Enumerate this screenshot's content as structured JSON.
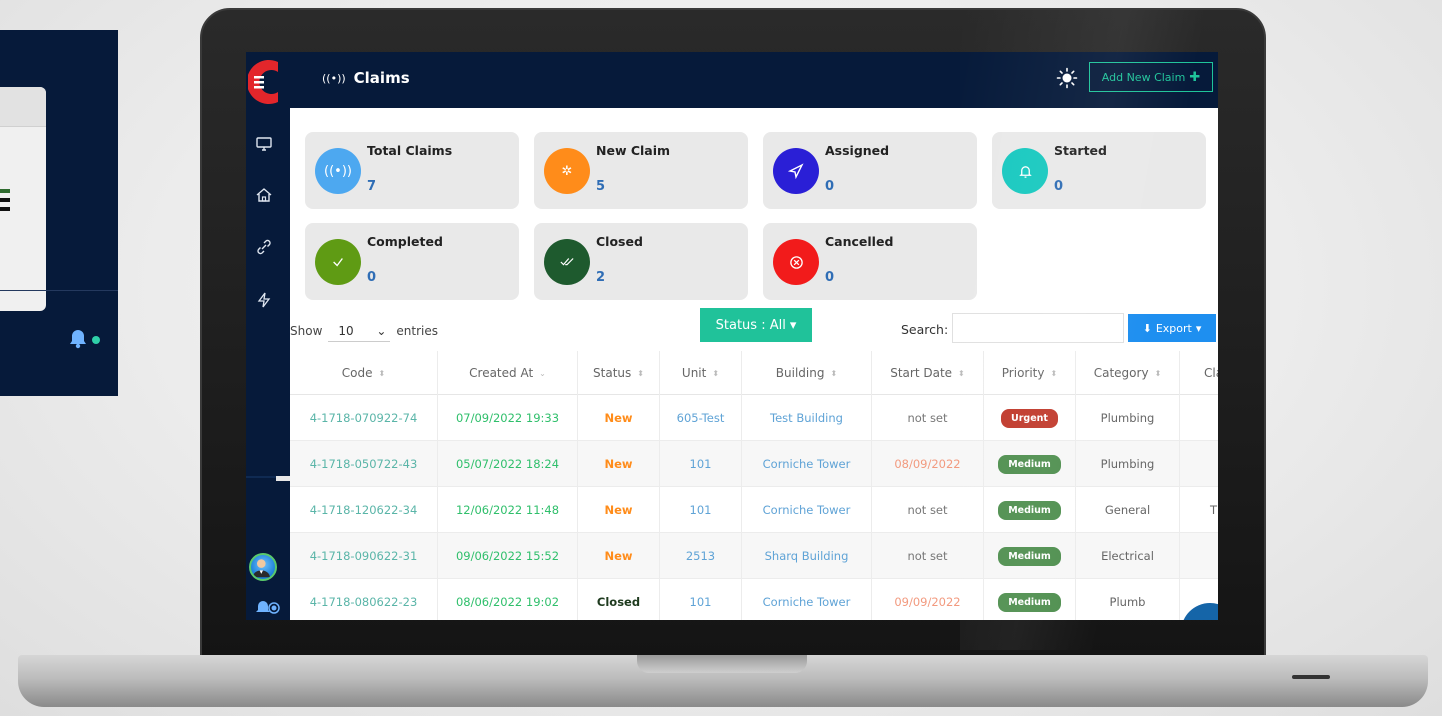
{
  "app": {
    "page_title": "Claims",
    "add_button_label": "Add New Claim",
    "colors": {
      "navy": "#061a3a",
      "teal": "#20c29a",
      "blue": "#1e8ff0"
    }
  },
  "stats": [
    {
      "label": "Total Claims",
      "value": "7",
      "color": "#4da8f0",
      "icon": "broadcast-icon"
    },
    {
      "label": "New Claim",
      "value": "5",
      "color": "#ff8c1a",
      "icon": "spinner-icon"
    },
    {
      "label": "Assigned",
      "value": "0",
      "color": "#2a1fd6",
      "icon": "send-icon"
    },
    {
      "label": "Started",
      "value": "0",
      "color": "#19c9c0",
      "icon": "bell-icon"
    },
    {
      "label": "Completed",
      "value": "0",
      "color": "#5f9b14",
      "icon": "check-icon"
    },
    {
      "label": "Closed",
      "value": "2",
      "color": "#1e5a2e",
      "icon": "double-check-icon"
    },
    {
      "label": "Cancelled",
      "value": "0",
      "color": "#f21b1b",
      "icon": "cancel-icon"
    }
  ],
  "controls": {
    "show_label": "Show",
    "entries_value": "10",
    "entries_label": "entries",
    "status_filter_label": "Status : All",
    "search_label": "Search:",
    "export_label": "Export"
  },
  "table": {
    "columns": [
      "Code",
      "Created At",
      "Status",
      "Unit",
      "Building",
      "Start Date",
      "Priority",
      "Category",
      "Cla"
    ],
    "rows": [
      {
        "code": "4-1718-070922-74",
        "created": "07/09/2022 19:33",
        "status": "New",
        "unit": "605-Test",
        "building": "Test Building",
        "start": "not set",
        "priority": "Urgent",
        "category": "Plumbing",
        "extra": ""
      },
      {
        "code": "4-1718-050722-43",
        "created": "05/07/2022 18:24",
        "status": "New",
        "unit": "101",
        "building": "Corniche Tower",
        "start": "08/09/2022",
        "priority": "Medium",
        "category": "Plumbing",
        "extra": ""
      },
      {
        "code": "4-1718-120622-34",
        "created": "12/06/2022 11:48",
        "status": "New",
        "unit": "101",
        "building": "Corniche Tower",
        "start": "not set",
        "priority": "Medium",
        "category": "General",
        "extra": "T"
      },
      {
        "code": "4-1718-090622-31",
        "created": "09/06/2022 15:52",
        "status": "New",
        "unit": "2513",
        "building": "Sharq Building",
        "start": "not set",
        "priority": "Medium",
        "category": "Electrical",
        "extra": ""
      },
      {
        "code": "4-1718-080622-23",
        "created": "08/06/2022 19:02",
        "status": "Closed",
        "unit": "101",
        "building": "Corniche Tower",
        "start": "09/09/2022",
        "priority": "Medium",
        "category": "Plumb",
        "extra": ""
      }
    ]
  }
}
